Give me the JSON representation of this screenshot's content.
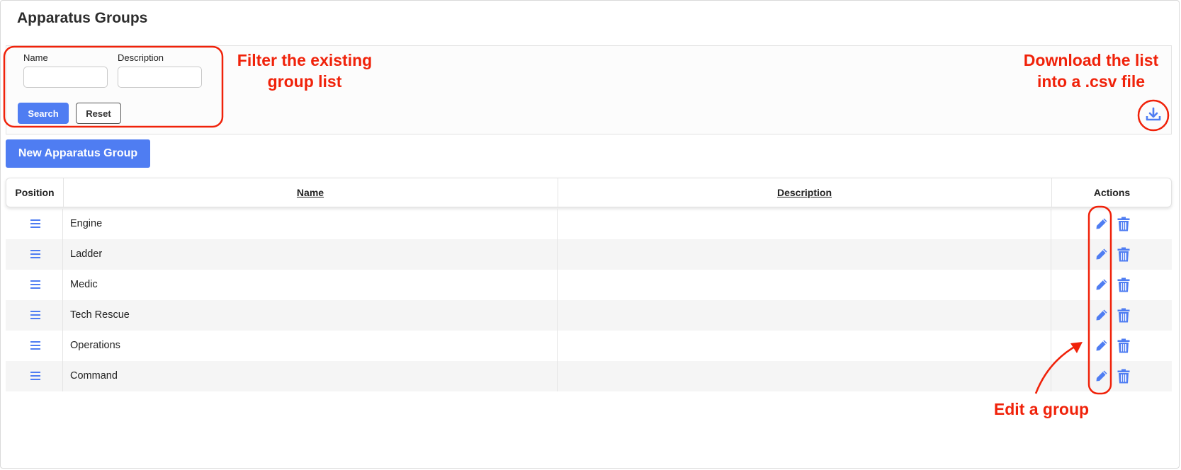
{
  "page": {
    "title": "Apparatus Groups"
  },
  "filter": {
    "name_label": "Name",
    "name_value": "",
    "description_label": "Description",
    "description_value": "",
    "search_label": "Search",
    "reset_label": "Reset"
  },
  "toolbar": {
    "new_group_label": "New Apparatus Group",
    "download_icon": "download-icon"
  },
  "table": {
    "columns": [
      "Position",
      "Name",
      "Description",
      "Actions"
    ],
    "rows": [
      {
        "name": "Engine",
        "description": ""
      },
      {
        "name": "Ladder",
        "description": ""
      },
      {
        "name": "Medic",
        "description": ""
      },
      {
        "name": "Tech Rescue",
        "description": ""
      },
      {
        "name": "Operations",
        "description": ""
      },
      {
        "name": "Command",
        "description": ""
      }
    ]
  },
  "annotations": {
    "filter_note_line1": "Filter the existing",
    "filter_note_line2": "group list",
    "download_note_line1": "Download the list",
    "download_note_line2": "into a .csv file",
    "edit_note": "Edit a group"
  },
  "colors": {
    "primary": "#4f7df2",
    "annotation": "#f0220a"
  }
}
